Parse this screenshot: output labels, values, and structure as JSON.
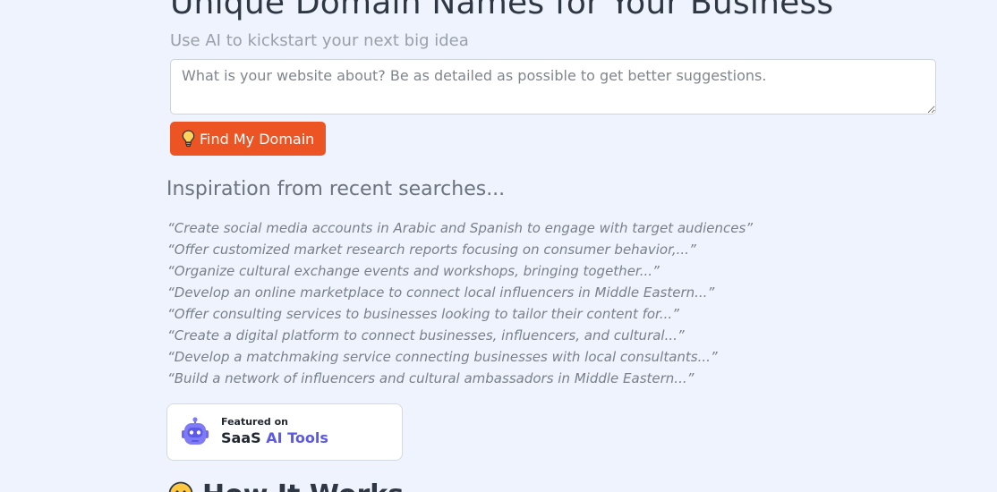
{
  "hero": {
    "title": "Unique Domain Names for Your Business",
    "subtitle": "Use AI to kickstart your next big idea"
  },
  "form": {
    "placeholder": "What is your website about? Be as detailed as possible to get better suggestions.",
    "value": "",
    "button_label": "Find My Domain",
    "button_icon": "lightbulb-icon",
    "button_color": "#ec5423"
  },
  "inspiration": {
    "heading": "Inspiration from recent searches...",
    "items": [
      "“Create social media accounts in Arabic and Spanish to engage with target audiences”",
      "“Offer customized market research reports focusing on consumer behavior,...”",
      "“Organize cultural exchange events and workshops, bringing together...”",
      "“Develop an online marketplace to connect local influencers in Middle Eastern...”",
      "“Offer consulting services to businesses looking to tailor their content for...”",
      "“Create a digital platform to connect businesses, influencers, and cultural...”",
      "“Develop a matchmaking service connecting businesses with local consultants...”",
      "“Build a network of influencers and cultural ambassadors in Middle Eastern...”"
    ]
  },
  "badge": {
    "small_text": "Featured on",
    "brand_part1": "SaaS",
    "brand_part2": "AI Tools",
    "icon": "robot-icon",
    "accent_color": "#5b59e6"
  },
  "next_section": {
    "heading": "How It Works",
    "icon": "emoji-icon"
  },
  "colors": {
    "background": "#eef3fd",
    "primary": "#ec5423"
  }
}
